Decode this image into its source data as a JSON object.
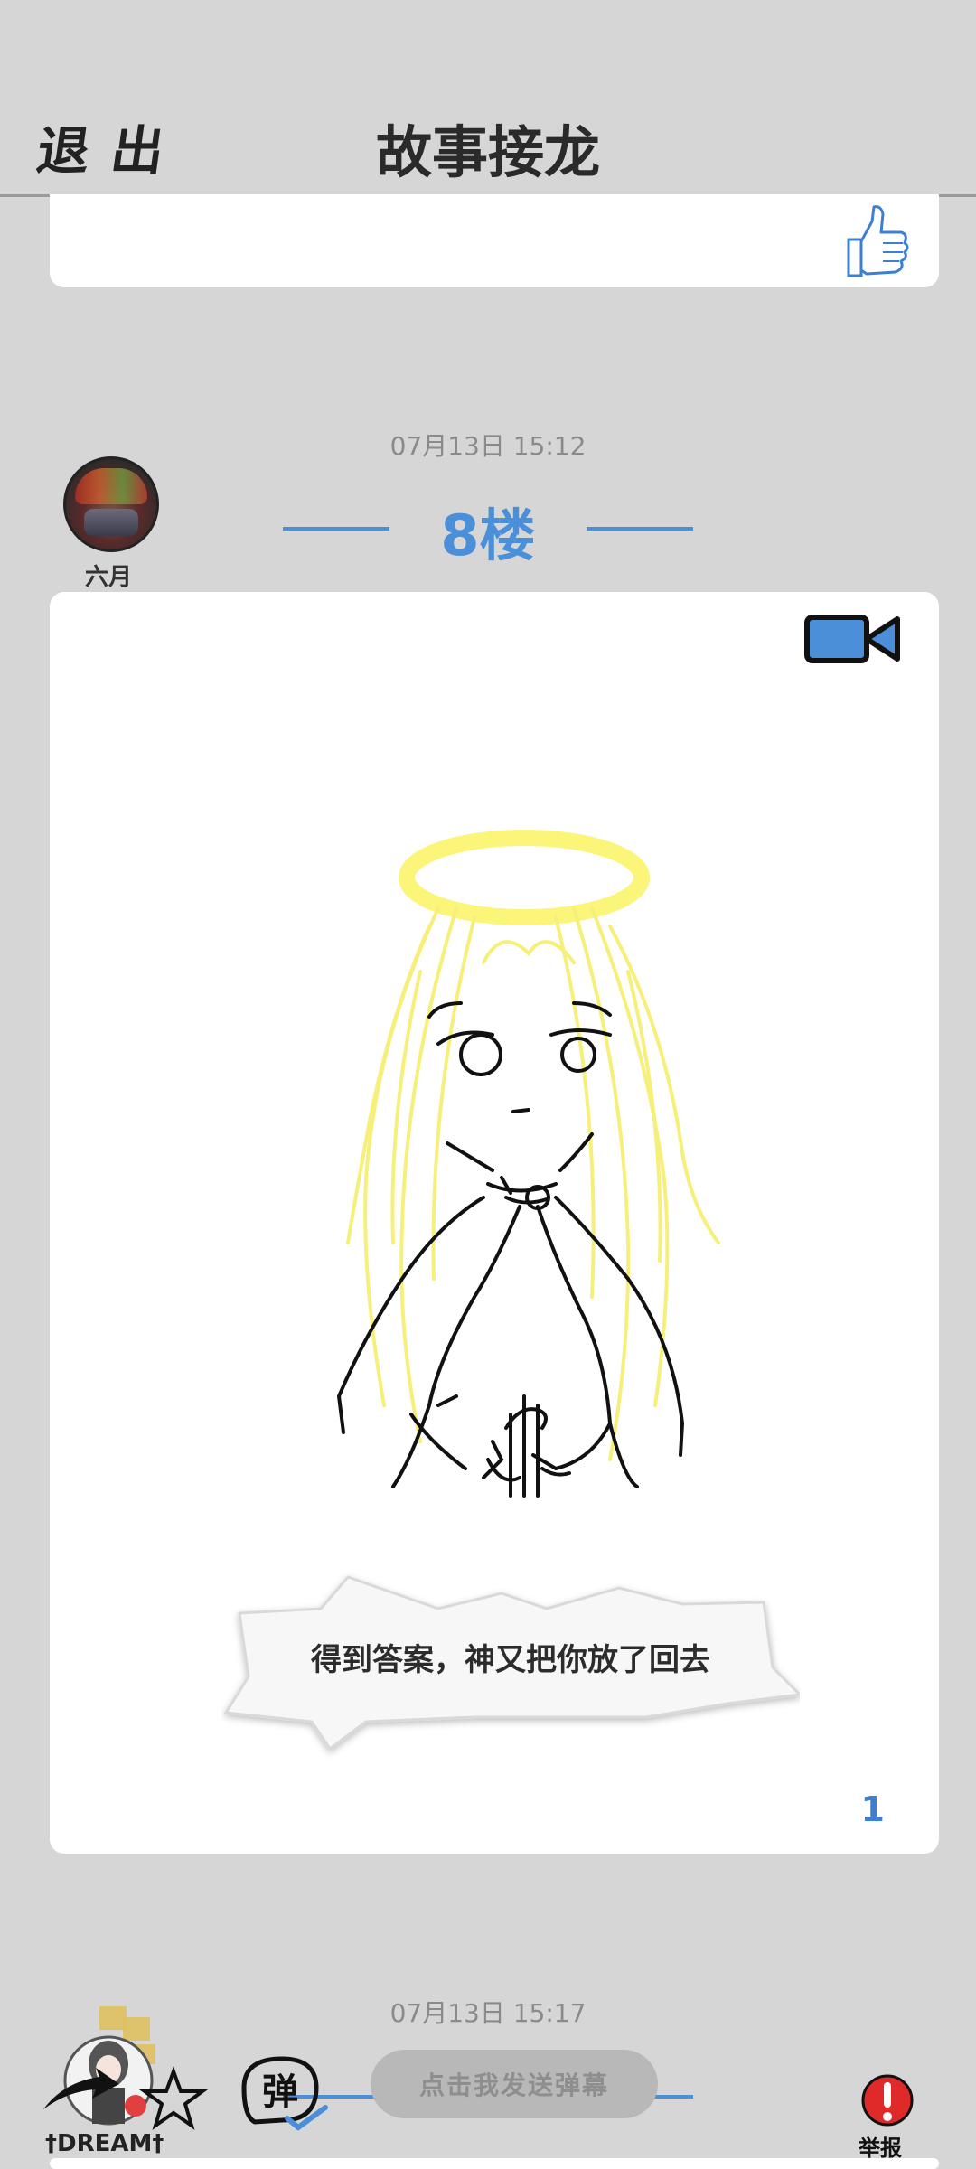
{
  "header": {
    "exit_label": "退出",
    "title": "故事接龙"
  },
  "post": {
    "timestamp": "07月13日  15:12",
    "floor": "8楼",
    "author": "六月",
    "caption": "得到答案，神又把你放了回去",
    "page_number": "1",
    "accent_color": "#4a8fd8"
  },
  "next_post": {
    "timestamp": "07月13日  15:17"
  },
  "toolbar": {
    "badge_name": "†DREAM†",
    "send_danmaku_label": "点击我发送弹幕",
    "danmaku_toggle_glyph": "弹",
    "report_label": "举报"
  },
  "icons": [
    "thumbs-up-icon",
    "video-camera-icon",
    "share-icon",
    "star-icon",
    "danmaku-toggle-icon",
    "report-icon"
  ]
}
